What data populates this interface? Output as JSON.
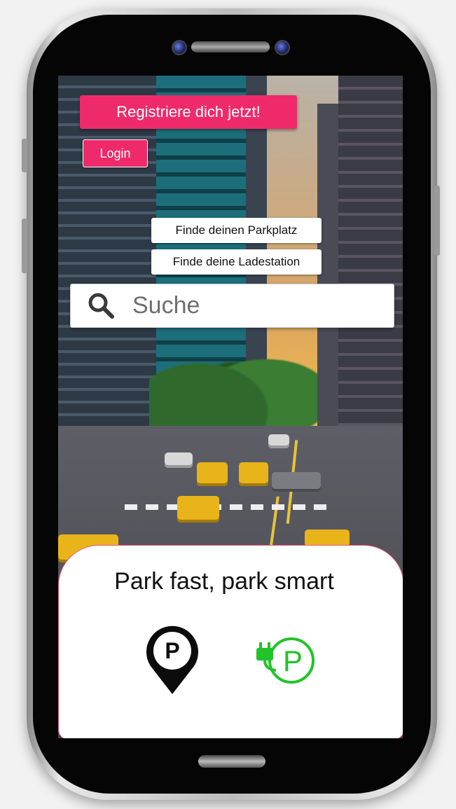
{
  "header": {
    "register_button": "Registriere dich jetzt!",
    "login_button": "Login"
  },
  "quick_actions": {
    "find_parking": "Finde deinen Parkplatz",
    "find_charging": "Finde deine Ladestation"
  },
  "search": {
    "placeholder": "Suche",
    "icon": "search-icon"
  },
  "bottom_card": {
    "tagline": "Park fast, park smart",
    "icons": [
      "parking-pin-icon",
      "ev-charging-parking-icon"
    ]
  },
  "colors": {
    "accent": "#ef2a6b",
    "charging_green": "#22c32a",
    "text": "#111111"
  }
}
